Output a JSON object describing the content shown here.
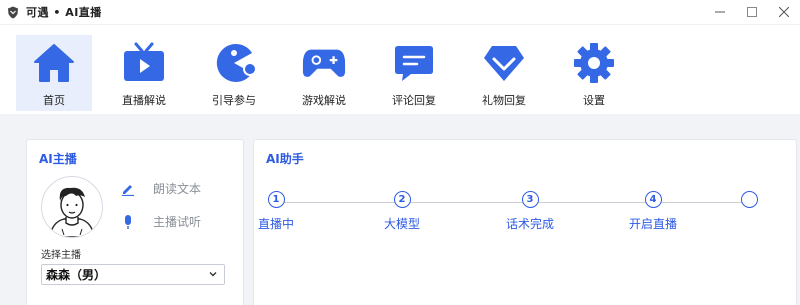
{
  "window": {
    "title": "可遇 • AI直播",
    "icons": [
      "app-shield-icon",
      "minimize-icon",
      "maximize-icon",
      "close-icon"
    ]
  },
  "toolbar": {
    "items": [
      {
        "label": "首页",
        "icon": "home-icon",
        "active": true
      },
      {
        "label": "直播解说",
        "icon": "tv-play-icon",
        "active": false
      },
      {
        "label": "引导参与",
        "icon": "pacman-icon",
        "active": false
      },
      {
        "label": "游戏解说",
        "icon": "gamepad-icon",
        "active": false
      },
      {
        "label": "评论回复",
        "icon": "comment-icon",
        "active": false
      },
      {
        "label": "礼物回复",
        "icon": "gift-diamond-icon",
        "active": false
      },
      {
        "label": "设置",
        "icon": "gear-icon",
        "active": false
      }
    ]
  },
  "anchor_panel": {
    "title": "AI主播",
    "avatar_icon": "avatar-illustration",
    "read_text_label": "朗读文本",
    "read_text_icon": "pen-icon",
    "preview_label": "主播试听",
    "preview_icon": "microphone-icon",
    "select_label": "选择主播",
    "select_value": "森森（男）"
  },
  "assistant_panel": {
    "title": "AI助手",
    "steps": [
      {
        "number": "①",
        "label": "直播中"
      },
      {
        "number": "②",
        "label": "大模型"
      },
      {
        "number": "③",
        "label": "话术完成"
      },
      {
        "number": "④",
        "label": "开启直播"
      },
      {
        "number": "",
        "label": ""
      }
    ]
  },
  "colors": {
    "accent": "#2d5be3",
    "icon_blue": "#3468e4",
    "active_bg": "#e8eefb",
    "page_bg": "#f2f3f7"
  }
}
